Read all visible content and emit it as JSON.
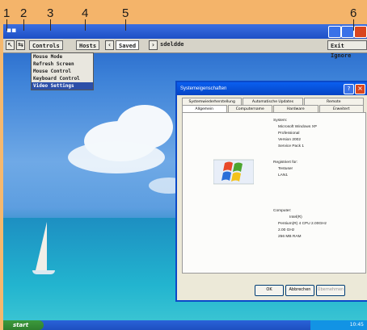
{
  "callouts": [
    "1",
    "2",
    "3",
    "4",
    "5",
    "6"
  ],
  "toolbar": {
    "controls_label": "Controls",
    "hosts_label": "Hosts",
    "saved_label": "Saved",
    "host_name": "sdeldde",
    "exit_label": "Exit Ignore"
  },
  "controls_menu": {
    "items": [
      "Mouse Mode",
      "Refresh Screen",
      "Mouse Control",
      "Keyboard Control",
      "Video Settings"
    ],
    "selected_index": 4
  },
  "sysprops": {
    "title": "Systemeigenschaften",
    "tabs_row1": [
      "Systemwiederherstellung",
      "Automatische Updates",
      "Remote"
    ],
    "tabs_row2": [
      "Allgemein",
      "Computername",
      "Hardware",
      "Erweitert"
    ],
    "active_tab": "Allgemein",
    "system_heading": "System:",
    "system_lines": [
      "Microsoft Windows XP",
      "Professional",
      "Version 2002",
      "Service Pack 1"
    ],
    "registered_heading": "Registriert für:",
    "registered_lines": [
      "Testuser",
      "LAN1"
    ],
    "computer_heading": "Computer:",
    "computer_lines": [
      "Intel(R)",
      "Pentium(R) 4 CPU 2.00GHz",
      "2.00 GHz",
      "256 MB RAM"
    ],
    "ok_label": "OK",
    "cancel_label": "Abbrechen",
    "apply_label": "Übernehmen"
  },
  "taskbar": {
    "start_label": "start",
    "clock": "10:45"
  },
  "colors": {
    "background": "#f4b46a",
    "title_blue": "#0a5ff0",
    "menu_highlight": "#2c4fa8"
  }
}
